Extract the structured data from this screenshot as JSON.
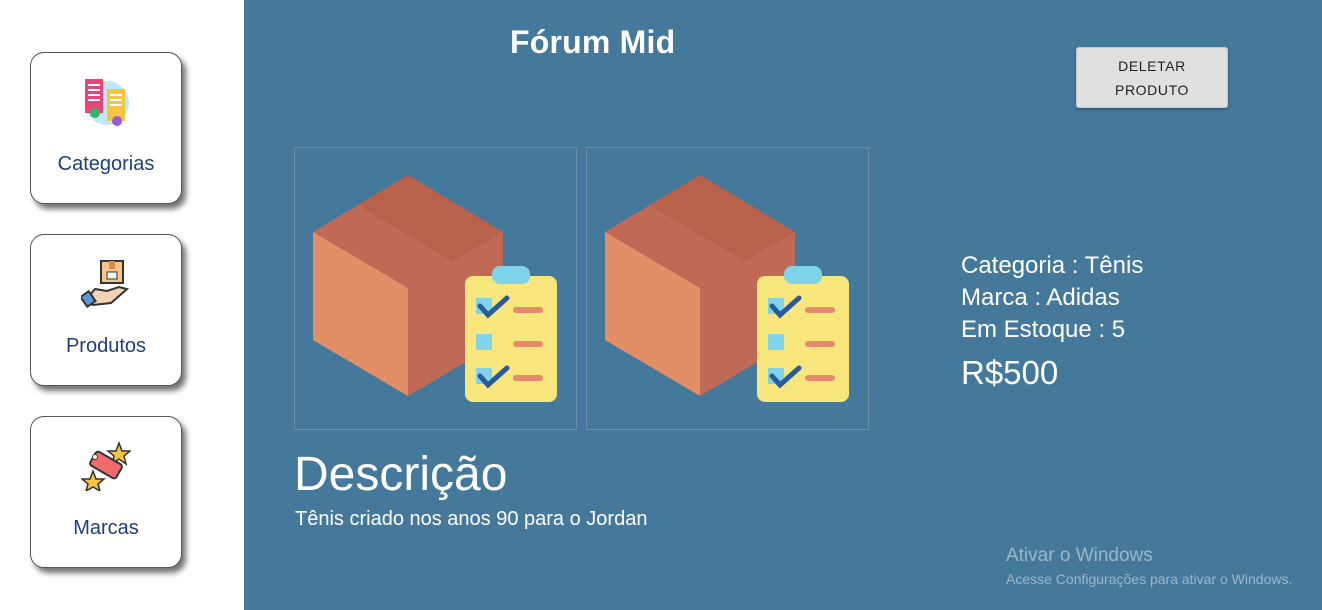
{
  "sidebar": {
    "items": [
      {
        "label": "Categorias",
        "icon": "categories-icon"
      },
      {
        "label": "Produtos",
        "icon": "products-icon"
      },
      {
        "label": "Marcas",
        "icon": "brands-icon"
      }
    ]
  },
  "header": {
    "title": "Fórum Mid",
    "delete_button": {
      "line1": "DELETAR",
      "line2": "PRODUTO"
    }
  },
  "product": {
    "images": [
      {
        "icon": "product-box-checklist-icon"
      },
      {
        "icon": "product-box-checklist-icon"
      }
    ],
    "category": "Categoria : Tênis",
    "brand": "Marca : Adidas",
    "stock": "Em Estoque : 5",
    "price": "R$500",
    "description_title": "Descrição",
    "description": "Tênis criado nos anos 90 para o Jordan"
  },
  "watermark": {
    "line1": "Ativar o Windows",
    "line2": "Acesse Configurações para ativar o Windows."
  },
  "colors": {
    "main_bg": "#45799c",
    "sidebar_bg": "#ffffff",
    "nav_label": "#1f3f7a",
    "button_bg": "#e0e0e0"
  }
}
